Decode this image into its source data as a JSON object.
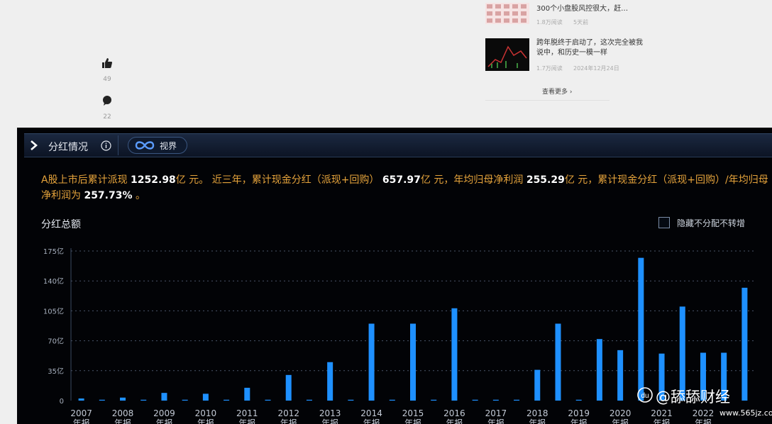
{
  "side": {
    "like_count": "49",
    "comment_count": "22"
  },
  "feed": {
    "item1": {
      "title": "300个小盘股风控很大，赶…",
      "reads": "1.8万阅读",
      "time": "5天前"
    },
    "item2": {
      "title": "跨年脱终于启动了，这次完全被我说中，和历史一模一样",
      "reads": "1.7万阅读",
      "time": "2024年12月24日"
    },
    "more": "查看更多",
    "more_arrow": "›"
  },
  "panel": {
    "title": "分红情况",
    "badge": "视界",
    "summary": {
      "s1": "A股上市后累计派现 ",
      "v1": "1252.98",
      "s2": "亿 元。 近三年，累计现金分红（派现+回购） ",
      "v2": "657.97",
      "s3": "亿 元，年均归母净利润 ",
      "v3": "255.29",
      "s4": "亿 元，累计现金分红（派现+回购）/年均归母净利润为 ",
      "v4": "257.73%",
      "s5": " 。"
    },
    "chart_title": "分红总额",
    "hide_label": "隐藏不分配不转增"
  },
  "colors": {
    "bar": "#1e90ff",
    "summary_text": "#e5a33b",
    "panel_bg": "#020306",
    "header_bg": "#13203a"
  },
  "chart_data": {
    "type": "bar",
    "title": "分红总额",
    "ylim": [
      0,
      175
    ],
    "yticks": [
      0,
      35,
      70,
      105,
      140,
      175
    ],
    "ytick_labels": [
      "0",
      "35亿",
      "70亿",
      "105亿",
      "140亿",
      "175亿"
    ],
    "grid": true,
    "categories": [
      "2007",
      "",
      "2008",
      "",
      "2009",
      "",
      "2010",
      "",
      "2011",
      "",
      "2012",
      "",
      "2013",
      "",
      "2014",
      "",
      "2015",
      "",
      "2016",
      "",
      "2017",
      "",
      "2018",
      "",
      "2019",
      "",
      "2020",
      "",
      "2021",
      "",
      "2022",
      "",
      ""
    ],
    "x_period_label": "年报",
    "values": [
      2.5,
      1,
      3.5,
      1,
      9,
      1,
      8,
      1,
      15,
      1,
      30,
      1,
      45,
      1,
      90,
      1,
      90,
      1,
      108,
      1,
      1,
      1,
      36,
      90,
      1,
      72,
      59,
      167,
      55,
      110,
      56,
      56,
      132
    ]
  },
  "watermark": {
    "text": "@舔舔财经",
    "site": "www.565jz.com"
  }
}
